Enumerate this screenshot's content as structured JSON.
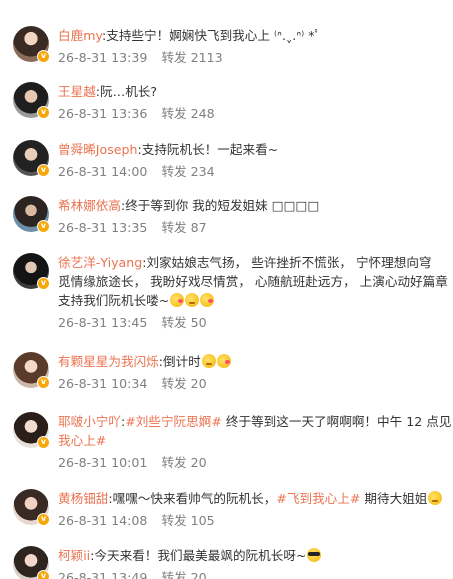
{
  "comments": [
    {
      "name": "白鹿my",
      "lines": [
        [
          {
            "t": ":支持些宁！婀娴快飞到我心上 ⁽ᐢ.ˬ.ᐢ⁾ *ﾟ"
          }
        ]
      ],
      "time": "26-8-31 13:39",
      "repost": "转发 2113"
    },
    {
      "name": "王星越",
      "lines": [
        [
          {
            "t": ":阮…机长?"
          }
        ]
      ],
      "time": "26-8-31 13:36",
      "repost": "转发 248"
    },
    {
      "name": "曾舜晞Joseph",
      "lines": [
        [
          {
            "t": ":支持阮机长！一起来看~"
          }
        ]
      ],
      "time": "26-8-31 14:00",
      "repost": "转发 234"
    },
    {
      "name": "希林娜依高",
      "lines": [
        [
          {
            "t": ":终于等到你 我的短发姐妹 □□□□"
          }
        ]
      ],
      "time": "26-8-31 13:35",
      "repost": "转发 87"
    },
    {
      "name": "徐艺洋-Yiyang",
      "lines": [
        [
          {
            "t": ":刘家姑娘志气扬， 些许挫折不慌张， 宁怀理想向穹"
          }
        ],
        [
          {
            "t": "觅情缘旅途长， 我盼好戏尽情赏， 心随航班赴远方， 上演心动好篇章"
          }
        ],
        [
          {
            "t": "支持我们阮机长喽~"
          },
          {
            "emoji": "kiss"
          },
          {
            "emoji": "face"
          },
          {
            "emoji": "kiss"
          }
        ]
      ],
      "time": "26-8-31 13:45",
      "repost": "转发 50"
    },
    {
      "name": "有颗星星为我闪烁",
      "lines": [
        [
          {
            "t": ":倒计时"
          },
          {
            "emoji": "face"
          },
          {
            "emoji": "kiss"
          }
        ]
      ],
      "time": "26-8-31 10:34",
      "repost": "转发 20"
    },
    {
      "name": "耶啵小宁吖",
      "lines": [
        [
          {
            "t": ":"
          },
          {
            "tag": "#刘些宁阮思婀#"
          },
          {
            "t": " 终于等到这一天了啊啊啊！中午 12 点见"
          }
        ],
        [
          {
            "tag": "我心上#"
          }
        ]
      ],
      "time": "26-8-31 10:01",
      "repost": "转发 20"
    },
    {
      "name": "黄杨钿甜",
      "lines": [
        [
          {
            "t": ":嘿嘿～快来看帅气的阮机长，"
          },
          {
            "tag": "#飞到我心上#"
          },
          {
            "t": " 期待大姐姐"
          },
          {
            "emoji": "face"
          }
        ]
      ],
      "time": "26-8-31 14:08",
      "repost": "转发 105"
    },
    {
      "name": "柯颖ii",
      "lines": [
        [
          {
            "t": ":今天来看！我们最美最飒的阮机长呀~"
          },
          {
            "emoji": "cool"
          }
        ]
      ],
      "time": "26-8-31 13:49",
      "repost": "转发 20"
    }
  ],
  "verified_badge": "v",
  "colors": {
    "username": "#eb7350",
    "meta": "#808080",
    "text": "#333333"
  },
  "icons": {
    "avatar": "avatar-image",
    "verified": "verified-badge-icon"
  }
}
